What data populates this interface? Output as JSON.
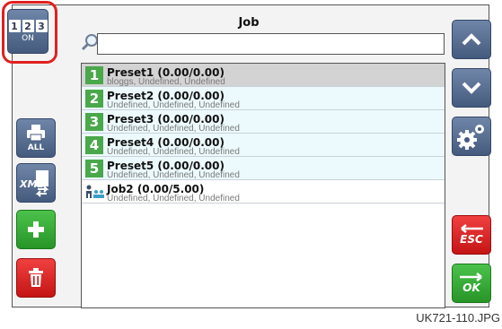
{
  "header": {
    "title": "Job"
  },
  "toolbar": {
    "numbers_button": {
      "digits": [
        "1",
        "2",
        "3"
      ],
      "state": "ON"
    },
    "print_button_label": "ALL",
    "xml_label": "XML"
  },
  "side_buttons": {
    "esc_label": "ESC",
    "ok_label": "OK"
  },
  "search": {
    "value": "",
    "placeholder": ""
  },
  "list": {
    "items": [
      {
        "num": "1",
        "title": "Preset1 (0.00/0.00)",
        "subtitle": "bloggs, Undefined, Undefined"
      },
      {
        "num": "2",
        "title": "Preset2 (0.00/0.00)",
        "subtitle": "Undefined, Undefined, Undefined"
      },
      {
        "num": "3",
        "title": "Preset3 (0.00/0.00)",
        "subtitle": "Undefined, Undefined, Undefined"
      },
      {
        "num": "4",
        "title": "Preset4 (0.00/0.00)",
        "subtitle": "Undefined, Undefined, Undefined"
      },
      {
        "num": "5",
        "title": "Preset5 (0.00/0.00)",
        "subtitle": "Undefined, Undefined, Undefined"
      },
      {
        "num": "",
        "title": "Job2 (0.00/5.00)",
        "subtitle": "Undefined, Undefined, Undefined"
      }
    ]
  },
  "footer": {
    "caption": "UK721-110.JPG"
  },
  "colors": {
    "accent_blue": "#4f6689",
    "green": "#36a836",
    "red": "#e02424",
    "list_highlight": "#ecfafd"
  }
}
